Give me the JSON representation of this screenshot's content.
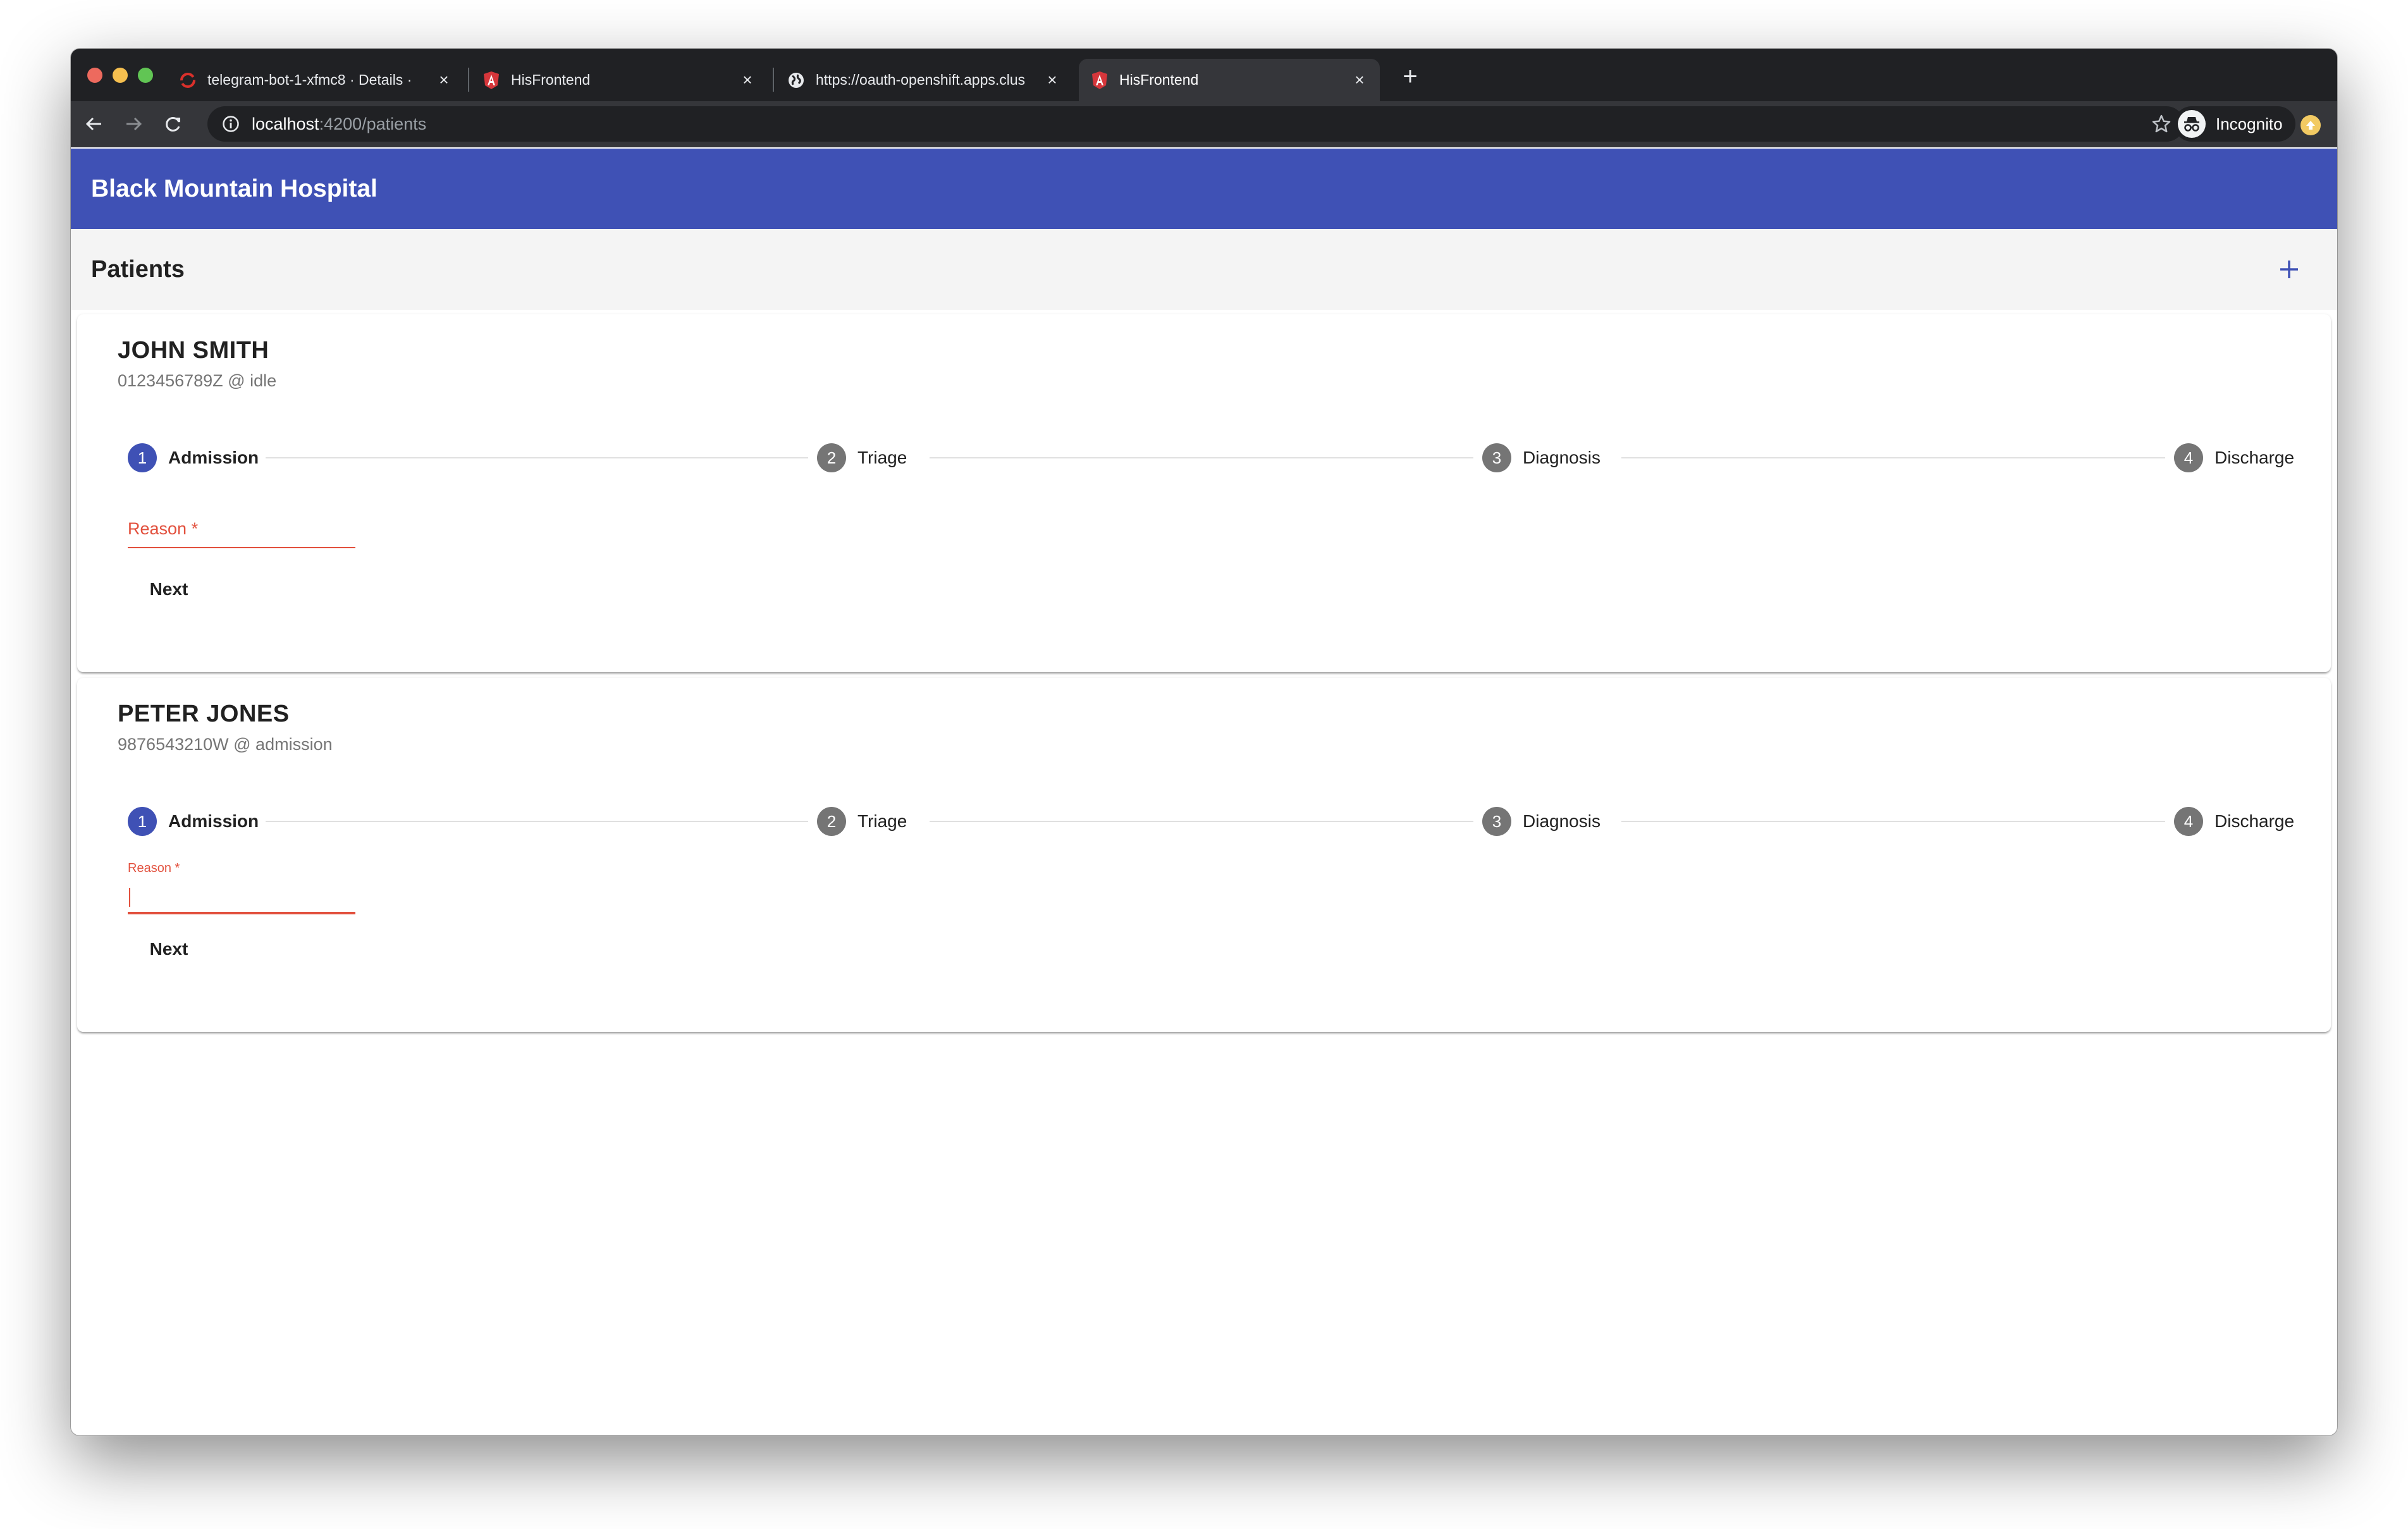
{
  "browser": {
    "tabs": [
      {
        "title": "telegram-bot-1-xfmc8 · Details ·",
        "favicon": "openshift-icon",
        "active": false
      },
      {
        "title": "HisFrontend",
        "favicon": "angular-icon",
        "active": false
      },
      {
        "title": "https://oauth-openshift.apps.clus",
        "favicon": "globe-icon",
        "active": false
      },
      {
        "title": "HisFrontend",
        "favicon": "angular-icon",
        "active": true
      }
    ],
    "close_glyph": "×",
    "new_tab_glyph": "+",
    "url_host": "localhost",
    "url_rest": ":4200/patients",
    "profile_label": "Incognito"
  },
  "app": {
    "title": "Black Mountain Hospital",
    "primary_color": "#3f51b5",
    "error_color": "#e2503d",
    "section_title": "Patients",
    "add_icon": "plus-icon"
  },
  "patients": [
    {
      "name": "JOHN SMITH",
      "subtitle": "0123456789Z @ idle",
      "steps": [
        {
          "num": "1",
          "label": "Admission",
          "active": true
        },
        {
          "num": "2",
          "label": "Triage",
          "active": false
        },
        {
          "num": "3",
          "label": "Diagnosis",
          "active": false
        },
        {
          "num": "4",
          "label": "Discharge",
          "active": false
        }
      ],
      "field": {
        "label": "Reason *",
        "value": "",
        "focused": false
      },
      "next_label": "Next"
    },
    {
      "name": "PETER JONES",
      "subtitle": "9876543210W @ admission",
      "steps": [
        {
          "num": "1",
          "label": "Admission",
          "active": true
        },
        {
          "num": "2",
          "label": "Triage",
          "active": false
        },
        {
          "num": "3",
          "label": "Diagnosis",
          "active": false
        },
        {
          "num": "4",
          "label": "Discharge",
          "active": false
        }
      ],
      "field": {
        "label": "Reason *",
        "value": "",
        "focused": true
      },
      "next_label": "Next"
    }
  ]
}
